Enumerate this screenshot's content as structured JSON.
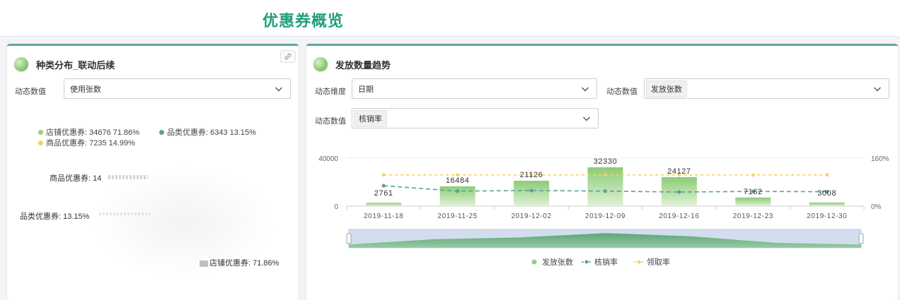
{
  "header": {
    "title": "优惠券概览"
  },
  "left_panel": {
    "title": "种类分布_联动后续",
    "field_label": "动态数值",
    "field_value": "使用张数",
    "legend": [
      {
        "text": "店铺优惠券: 34676 71.86%",
        "color": "#93d07c"
      },
      {
        "text": "品类优惠券: 6343 13.15%",
        "color": "#5aa19c"
      },
      {
        "text": "商品优惠券: 7235 14.99%",
        "color": "#f5d35c"
      }
    ],
    "pie_labels": {
      "product": "商品优惠券: 14",
      "category": "品类优惠券: 13.15%",
      "store": "店铺优惠券: 71.86%"
    }
  },
  "right_panel": {
    "title": "发放数量趋势",
    "dim_label": "动态维度",
    "dim_value": "日期",
    "value_label": "动态数值",
    "value_tag": "发放张数",
    "value2_label": "动态数值",
    "value2_tag": "核销率"
  },
  "chart_data": {
    "type": "bar",
    "categories": [
      "2019-11-18",
      "2019-11-25",
      "2019-12-02",
      "2019-12-09",
      "2019-12-16",
      "2019-12-23",
      "2019-12-30"
    ],
    "y_left_ticks": [
      "40000",
      "0"
    ],
    "y_right_ticks": [
      "160%",
      "0%"
    ],
    "ylim_left": [
      0,
      40000
    ],
    "ylim_right": [
      0,
      160
    ],
    "series": [
      {
        "name": "发放张数",
        "kind": "bar",
        "color": "#93d07c",
        "values": [
          2761,
          16484,
          21126,
          32330,
          24127,
          7162,
          3008
        ]
      },
      {
        "name": "核销率",
        "kind": "line",
        "color": "#5aa19c",
        "axis": "right",
        "values": [
          68,
          50,
          52,
          50,
          47,
          49,
          48
        ]
      },
      {
        "name": "领取率",
        "kind": "line",
        "color": "#f5d35c",
        "axis": "right",
        "values": [
          104,
          104,
          104,
          104,
          104,
          104,
          104
        ]
      }
    ],
    "legend_position": "bottom",
    "data_zoom": true
  }
}
